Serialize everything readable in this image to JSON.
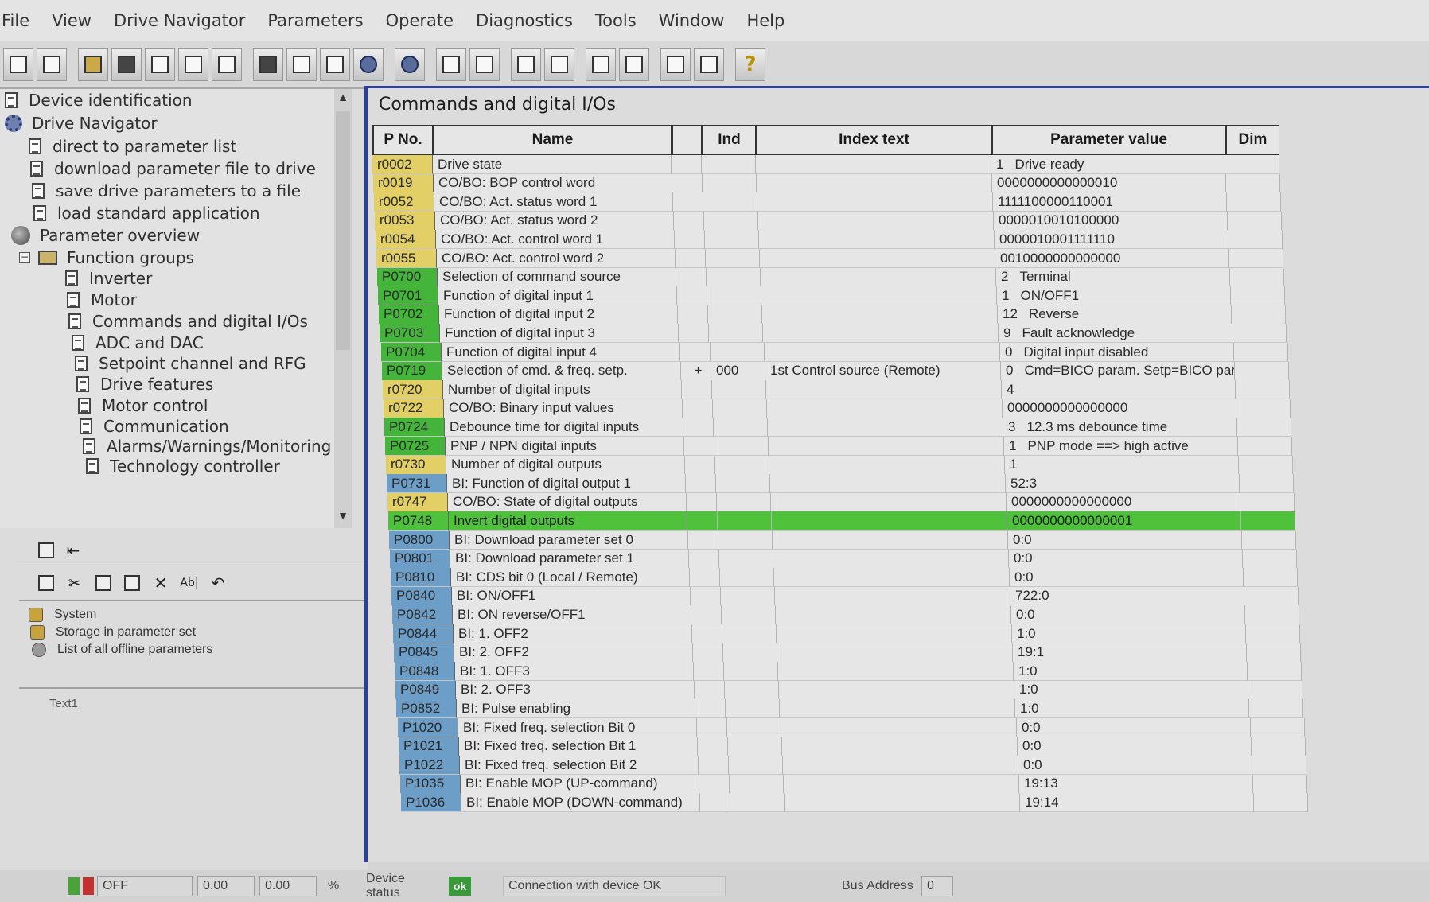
{
  "menu": [
    "File",
    "View",
    "Drive Navigator",
    "Parameters",
    "Operate",
    "Diagnostics",
    "Tools",
    "Window",
    "Help"
  ],
  "tree": {
    "items": [
      {
        "label": "Device identification",
        "icon": "doc-icon"
      },
      {
        "label": "Drive Navigator",
        "icon": "gear-icon"
      },
      {
        "label": "direct to parameter list",
        "icon": "doc-icon"
      },
      {
        "label": "download parameter file to drive",
        "icon": "doc-icon"
      },
      {
        "label": "save drive parameters to a file",
        "icon": "doc-icon"
      },
      {
        "label": "load standard application",
        "icon": "doc-icon"
      },
      {
        "label": "Parameter overview",
        "icon": "globe-icon"
      },
      {
        "label": "Function groups",
        "icon": "folder-icon"
      },
      {
        "label": "Inverter",
        "icon": "doc-icon"
      },
      {
        "label": "Motor",
        "icon": "doc-icon"
      },
      {
        "label": "Commands and digital I/Os",
        "icon": "doc-icon"
      },
      {
        "label": "ADC and DAC",
        "icon": "doc-icon"
      },
      {
        "label": "Setpoint channel and RFG",
        "icon": "doc-icon"
      },
      {
        "label": "Drive features",
        "icon": "doc-icon"
      },
      {
        "label": "Motor control",
        "icon": "doc-icon"
      },
      {
        "label": "Communication",
        "icon": "doc-icon"
      },
      {
        "label": "Alarms/Warnings/Monitoring",
        "icon": "doc-icon"
      },
      {
        "label": "Technology controller",
        "icon": "doc-icon"
      }
    ],
    "expander": "−"
  },
  "edit_toolbar": {
    "rename_label": "Ab|"
  },
  "system_list": [
    {
      "label": "System",
      "icon": "lock-icon"
    },
    {
      "label": "Storage in parameter set",
      "icon": "lock-icon"
    },
    {
      "label": "List of all offline parameters",
      "icon": "eye-icon"
    }
  ],
  "text_area_label": "Text1",
  "panel": {
    "title": "Commands and digital I/Os",
    "columns": [
      "P No.",
      "Name",
      "",
      "Ind",
      "Index text",
      "Parameter value",
      "Dim"
    ],
    "rows": [
      {
        "pno": "r0002",
        "type": "yellow",
        "name": "Drive state",
        "exp": "",
        "ind": "",
        "itext": "",
        "vcode": "1",
        "vtext": "Drive ready"
      },
      {
        "pno": "r0019",
        "type": "yellow",
        "name": "CO/BO: BOP control word",
        "exp": "",
        "ind": "",
        "itext": "",
        "vcode": "",
        "vtext": "0000000000000010"
      },
      {
        "pno": "r0052",
        "type": "yellow",
        "name": "CO/BO: Act. status word 1",
        "exp": "",
        "ind": "",
        "itext": "",
        "vcode": "",
        "vtext": "1111100000110001"
      },
      {
        "pno": "r0053",
        "type": "yellow",
        "name": "CO/BO: Act. status word 2",
        "exp": "",
        "ind": "",
        "itext": "",
        "vcode": "",
        "vtext": "0000010010100000"
      },
      {
        "pno": "r0054",
        "type": "yellow",
        "name": "CO/BO: Act. control word 1",
        "exp": "",
        "ind": "",
        "itext": "",
        "vcode": "",
        "vtext": "0000010001111110"
      },
      {
        "pno": "r0055",
        "type": "yellow",
        "name": "CO/BO: Act. control word 2",
        "exp": "",
        "ind": "",
        "itext": "",
        "vcode": "",
        "vtext": "0010000000000000"
      },
      {
        "pno": "P0700",
        "type": "green",
        "name": "Selection of command source",
        "exp": "",
        "ind": "",
        "itext": "",
        "vcode": "2",
        "vtext": "Terminal"
      },
      {
        "pno": "P0701",
        "type": "green",
        "name": "Function of digital input 1",
        "exp": "",
        "ind": "",
        "itext": "",
        "vcode": "1",
        "vtext": "ON/OFF1"
      },
      {
        "pno": "P0702",
        "type": "green",
        "name": "Function of digital input 2",
        "exp": "",
        "ind": "",
        "itext": "",
        "vcode": "12",
        "vtext": "Reverse"
      },
      {
        "pno": "P0703",
        "type": "green",
        "name": "Function of digital input 3",
        "exp": "",
        "ind": "",
        "itext": "",
        "vcode": "9",
        "vtext": "Fault acknowledge"
      },
      {
        "pno": "P0704",
        "type": "green",
        "name": "Function of digital input 4",
        "exp": "",
        "ind": "",
        "itext": "",
        "vcode": "0",
        "vtext": "Digital input disabled"
      },
      {
        "pno": "P0719",
        "type": "green",
        "name": "Selection of cmd. & freq. setp.",
        "exp": "+",
        "ind": "000",
        "itext": "1st Control source (Remote)",
        "vcode": "0",
        "vtext": "Cmd=BICO param. Setp=BICO para"
      },
      {
        "pno": "r0720",
        "type": "yellow",
        "name": "Number of digital inputs",
        "exp": "",
        "ind": "",
        "itext": "",
        "vcode": "",
        "vtext": "4"
      },
      {
        "pno": "r0722",
        "type": "yellow",
        "name": "CO/BO: Binary input values",
        "exp": "",
        "ind": "",
        "itext": "",
        "vcode": "",
        "vtext": "0000000000000000"
      },
      {
        "pno": "P0724",
        "type": "green",
        "name": "Debounce time for digital inputs",
        "exp": "",
        "ind": "",
        "itext": "",
        "vcode": "3",
        "vtext": "12.3 ms debounce time"
      },
      {
        "pno": "P0725",
        "type": "green",
        "name": "PNP / NPN digital inputs",
        "exp": "",
        "ind": "",
        "itext": "",
        "vcode": "1",
        "vtext": "PNP mode ==> high active"
      },
      {
        "pno": "r0730",
        "type": "yellow",
        "name": "Number of digital outputs",
        "exp": "",
        "ind": "",
        "itext": "",
        "vcode": "",
        "vtext": "1"
      },
      {
        "pno": "P0731",
        "type": "blue",
        "name": "BI: Function of digital output 1",
        "exp": "",
        "ind": "",
        "itext": "",
        "vcode": "",
        "vtext": "52:3"
      },
      {
        "pno": "r0747",
        "type": "yellow",
        "name": "CO/BO: State of digital outputs",
        "exp": "",
        "ind": "",
        "itext": "",
        "vcode": "",
        "vtext": "0000000000000000"
      },
      {
        "pno": "P0748",
        "type": "green",
        "name": "Invert digital outputs",
        "exp": "",
        "ind": "",
        "itext": "",
        "vcode": "",
        "vtext": "0000000000000001",
        "selected": true
      },
      {
        "pno": "P0800",
        "type": "blue",
        "name": "BI: Download parameter set 0",
        "exp": "",
        "ind": "",
        "itext": "",
        "vcode": "",
        "vtext": "0:0"
      },
      {
        "pno": "P0801",
        "type": "blue",
        "name": "BI: Download parameter set 1",
        "exp": "",
        "ind": "",
        "itext": "",
        "vcode": "",
        "vtext": "0:0"
      },
      {
        "pno": "P0810",
        "type": "blue",
        "name": "BI: CDS bit 0 (Local / Remote)",
        "exp": "",
        "ind": "",
        "itext": "",
        "vcode": "",
        "vtext": "0:0"
      },
      {
        "pno": "P0840",
        "type": "blue",
        "name": "BI: ON/OFF1",
        "exp": "",
        "ind": "",
        "itext": "",
        "vcode": "",
        "vtext": "722:0"
      },
      {
        "pno": "P0842",
        "type": "blue",
        "name": "BI: ON reverse/OFF1",
        "exp": "",
        "ind": "",
        "itext": "",
        "vcode": "",
        "vtext": "0:0"
      },
      {
        "pno": "P0844",
        "type": "blue",
        "name": "BI: 1. OFF2",
        "exp": "",
        "ind": "",
        "itext": "",
        "vcode": "",
        "vtext": "1:0"
      },
      {
        "pno": "P0845",
        "type": "blue",
        "name": "BI: 2. OFF2",
        "exp": "",
        "ind": "",
        "itext": "",
        "vcode": "",
        "vtext": "19:1"
      },
      {
        "pno": "P0848",
        "type": "blue",
        "name": "BI: 1. OFF3",
        "exp": "",
        "ind": "",
        "itext": "",
        "vcode": "",
        "vtext": "1:0"
      },
      {
        "pno": "P0849",
        "type": "blue",
        "name": "BI: 2. OFF3",
        "exp": "",
        "ind": "",
        "itext": "",
        "vcode": "",
        "vtext": "1:0"
      },
      {
        "pno": "P0852",
        "type": "blue",
        "name": "BI: Pulse enabling",
        "exp": "",
        "ind": "",
        "itext": "",
        "vcode": "",
        "vtext": "1:0"
      },
      {
        "pno": "P1020",
        "type": "blue",
        "name": "BI: Fixed freq. selection Bit 0",
        "exp": "",
        "ind": "",
        "itext": "",
        "vcode": "",
        "vtext": "0:0"
      },
      {
        "pno": "P1021",
        "type": "blue",
        "name": "BI: Fixed freq. selection Bit 1",
        "exp": "",
        "ind": "",
        "itext": "",
        "vcode": "",
        "vtext": "0:0"
      },
      {
        "pno": "P1022",
        "type": "blue",
        "name": "BI: Fixed freq. selection Bit 2",
        "exp": "",
        "ind": "",
        "itext": "",
        "vcode": "",
        "vtext": "0:0"
      },
      {
        "pno": "P1035",
        "type": "blue",
        "name": "BI: Enable MOP (UP-command)",
        "exp": "",
        "ind": "",
        "itext": "",
        "vcode": "",
        "vtext": "19:13"
      },
      {
        "pno": "P1036",
        "type": "blue",
        "name": "BI: Enable MOP (DOWN-command)",
        "exp": "",
        "ind": "",
        "itext": "",
        "vcode": "",
        "vtext": "19:14"
      }
    ]
  },
  "status_bar": {
    "state": "OFF",
    "value1": "0.00",
    "value2": "0.00",
    "unit": "%",
    "device_status_label": "Device status",
    "device_status_value": "ok",
    "connection": "Connection with device OK",
    "bus_address_label": "Bus Address",
    "bus_address_value": "0"
  },
  "colors": {
    "yellow_param": "#e2cf66",
    "green_param": "#44b53a",
    "blue_param": "#6c9ec8",
    "selected_row": "#4ec23a",
    "panel_border": "#2c3f9a"
  }
}
